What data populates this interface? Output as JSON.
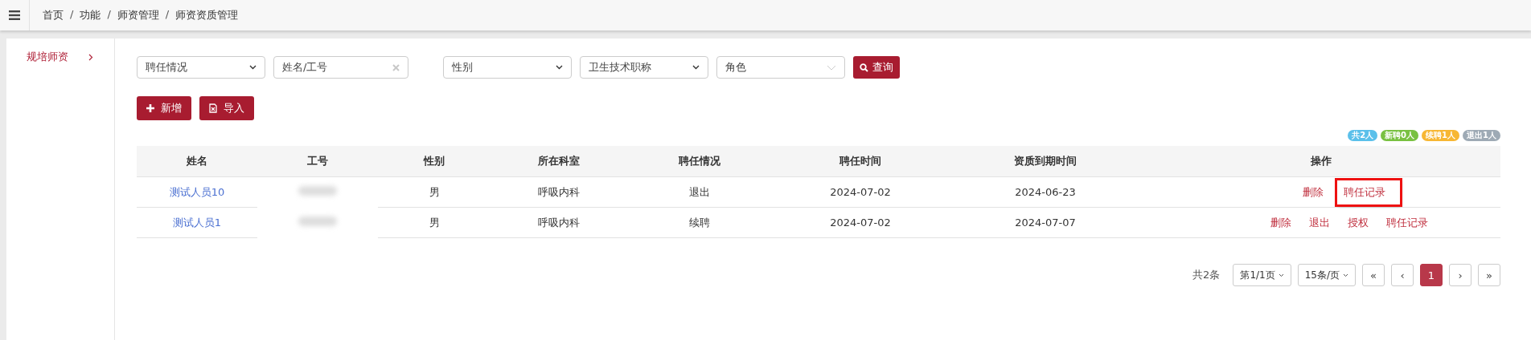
{
  "breadcrumb": [
    "首页",
    "功能",
    "师资管理",
    "师资资质管理"
  ],
  "breadcrumb_separator": "/",
  "sidebar": {
    "items": [
      {
        "label": "规培师资",
        "selected": true
      }
    ]
  },
  "filters": [
    {
      "kind": "select",
      "placeholder": "聘任情况"
    },
    {
      "kind": "input",
      "placeholder": "姓名/工号"
    },
    {
      "kind": "select",
      "placeholder": "性别"
    },
    {
      "kind": "select",
      "placeholder": "卫生技术职称"
    },
    {
      "kind": "combo",
      "placeholder": "角色"
    }
  ],
  "search_button": "查询",
  "toolbar_buttons": [
    {
      "kind": "add",
      "label": "新增"
    },
    {
      "kind": "import",
      "label": "导入"
    }
  ],
  "summary_badges": [
    {
      "label": "共2人",
      "color": "#5bc0ea"
    },
    {
      "label": "新聘0人",
      "color": "#79c141"
    },
    {
      "label": "续聘1人",
      "color": "#f7b733"
    },
    {
      "label": "退出1人",
      "color": "#9eaab5"
    }
  ],
  "table": {
    "columns": [
      "姓名",
      "工号",
      "性别",
      "所在科室",
      "聘任情况",
      "聘任时间",
      "资质到期时间",
      "操作"
    ],
    "rows": [
      {
        "name": "测试人员10",
        "gender": "男",
        "department": "呼吸内科",
        "status": "退出",
        "hire_date": "2024-07-02",
        "expiry_date": "2024-06-23",
        "actions": [
          {
            "label": "删除",
            "highlighted": false
          },
          {
            "label": "聘任记录",
            "highlighted": true
          }
        ]
      },
      {
        "name": "测试人员1",
        "gender": "男",
        "department": "呼吸内科",
        "status": "续聘",
        "hire_date": "2024-07-02",
        "expiry_date": "2024-07-07",
        "actions": [
          {
            "label": "删除",
            "highlighted": false
          },
          {
            "label": "退出",
            "highlighted": false
          },
          {
            "label": "授权",
            "highlighted": false
          },
          {
            "label": "聘任记录",
            "highlighted": false
          }
        ]
      }
    ]
  },
  "pagination": {
    "total": "共2条",
    "page_select": "第1/1页",
    "size_select": "15条/页",
    "buttons": [
      {
        "label": "«",
        "selected": false
      },
      {
        "label": "‹",
        "selected": false
      },
      {
        "label": "1",
        "selected": true
      },
      {
        "label": "›",
        "selected": false
      },
      {
        "label": "»",
        "selected": false
      }
    ]
  }
}
